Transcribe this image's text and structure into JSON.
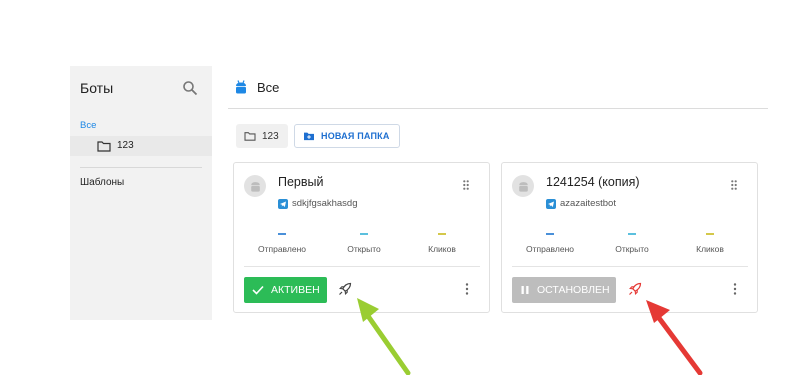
{
  "sidebar": {
    "title": "Боты",
    "all_label": "Все",
    "folder_label": "123",
    "templates_label": "Шаблоны",
    "icons": {
      "search": "search-icon",
      "folder": "folder-icon"
    }
  },
  "header": {
    "title": "Все",
    "icon": "bot-icon"
  },
  "folders": {
    "folder_chip_label": "123",
    "new_folder_label": "НОВАЯ ПАПКА"
  },
  "stats_labels": {
    "sent": "Отправлено",
    "opened": "Открыто",
    "clicks": "Кликов"
  },
  "stats_values": {
    "sent": "–",
    "opened": "–",
    "clicks": "–"
  },
  "cards": [
    {
      "name": "Первый",
      "channel": "sdkjfgsakhasdg",
      "status": "АКТИВЕН",
      "status_state": "active"
    },
    {
      "name": "1241254 (копия)",
      "channel": "azazaitestbot",
      "status": "ОСТАНОВЛЕН",
      "status_state": "stopped"
    }
  ],
  "colors": {
    "accent": "#1e88e5",
    "active": "#2cbc57",
    "stopped": "#bdbdbd",
    "telegram": "#2a8fd6",
    "sent_dash": "#4a90d9",
    "opened_dash": "#5bc0de",
    "clicks_dash": "#d4c84a",
    "green_arrow": "#9acd32",
    "red_arrow": "#e53935"
  }
}
